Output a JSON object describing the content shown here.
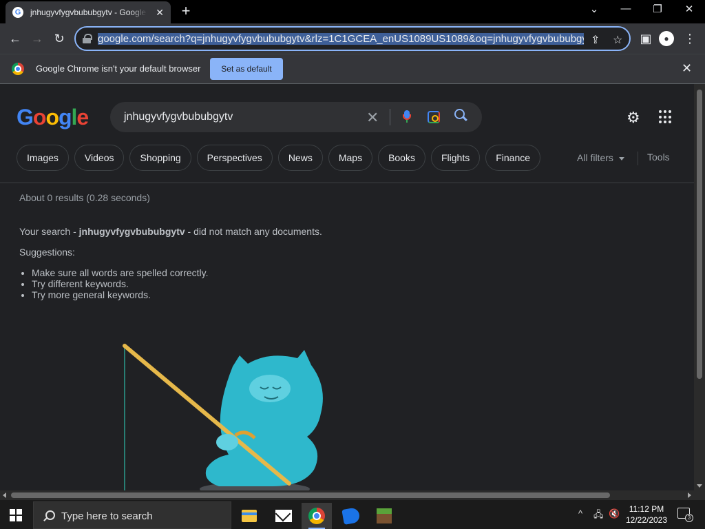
{
  "browser": {
    "tab": {
      "favicon_letter": "G",
      "title": "jnhugyvfygvbububgytv - Google Search",
      "close": "✕"
    },
    "new_tab": "+",
    "window_controls": {
      "collapse": "⌄",
      "minimize": "—",
      "restore": "❐",
      "close": "✕"
    },
    "toolbar": {
      "back": "←",
      "forward": "→",
      "reload": "↻",
      "url": "google.com/search?q=jnhugyvfygvbububgytv&rlz=1C1GCEA_enUS1089US1089&oq=jnhugyvfygvbububgytv&gs_lcrp=",
      "share": "⇪",
      "bookmark": "☆",
      "side_panel": "▣",
      "profile": "●",
      "menu": "⋮"
    },
    "infobar": {
      "message": "Google Chrome isn't your default browser",
      "button": "Set as default",
      "close": "✕"
    }
  },
  "google": {
    "logo_letters": [
      {
        "ch": "G",
        "color": "#4285f4"
      },
      {
        "ch": "o",
        "color": "#ea4335"
      },
      {
        "ch": "o",
        "color": "#fbbc05"
      },
      {
        "ch": "g",
        "color": "#4285f4"
      },
      {
        "ch": "l",
        "color": "#34a853"
      },
      {
        "ch": "e",
        "color": "#ea4335"
      }
    ],
    "query": "jnhugyvfygvbububgytv",
    "clear": "✕",
    "settings": "⚙",
    "filters": [
      "Images",
      "Videos",
      "Shopping",
      "Perspectives",
      "News",
      "Maps",
      "Books",
      "Flights",
      "Finance"
    ],
    "all_filters": "All filters",
    "tools": "Tools",
    "result_stats": "About 0 results (0.28 seconds)",
    "no_match_prefix": "Your search - ",
    "no_match_query": "jnhugyvfygvbububgytv",
    "no_match_suffix": " - did not match any documents.",
    "suggestions_heading": "Suggestions:",
    "suggestions": [
      "Make sure all words are spelled correctly.",
      "Try different keywords.",
      "Try more general keywords."
    ]
  },
  "taskbar": {
    "search_placeholder": "Type here to search",
    "tray": {
      "chevron": "^",
      "network": "🖧",
      "volume": "🔇"
    },
    "time": "11:12 PM",
    "date": "12/22/2023",
    "notification_count": "3"
  },
  "colors": {
    "accent": "#8ab4f8",
    "page_bg": "#202124",
    "chip_border": "#3c4043",
    "creature": "#2eb8cc",
    "rod": "#e6b84a"
  }
}
